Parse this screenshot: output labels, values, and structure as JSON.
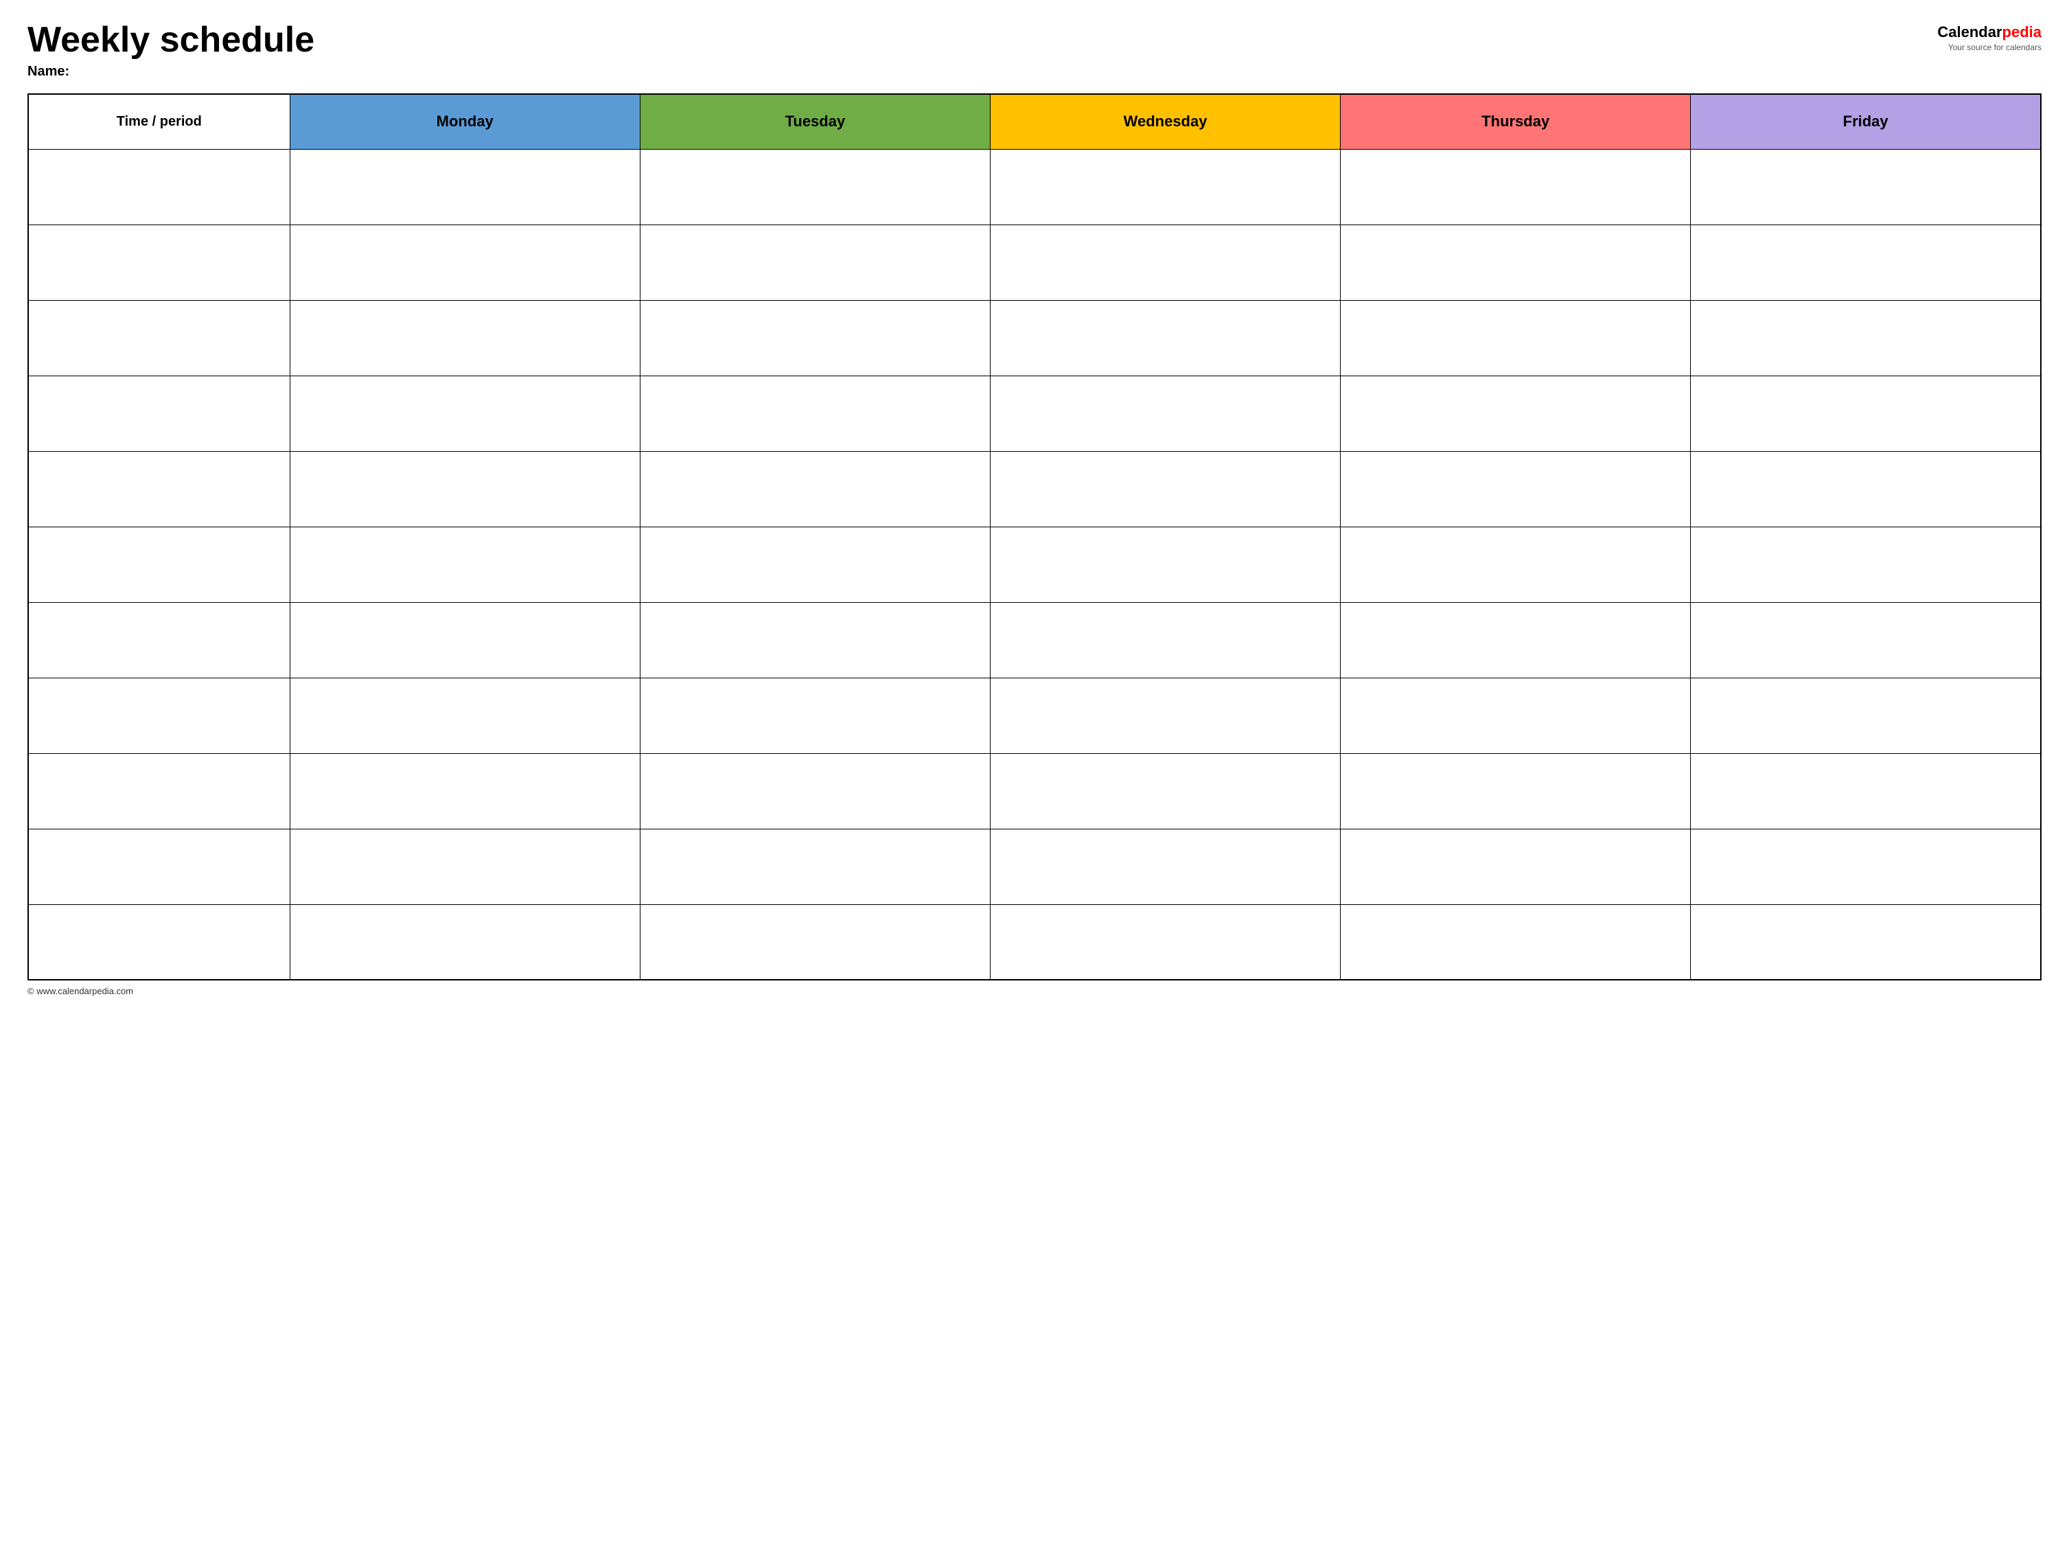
{
  "header": {
    "main_title": "Weekly schedule",
    "name_label": "Name:",
    "logo_calendar": "Calendar",
    "logo_pedia": "pedia",
    "logo_tagline": "Your source for calendars"
  },
  "table": {
    "columns": [
      {
        "key": "time",
        "label": "Time / period",
        "color": "#ffffff",
        "class": "col-time"
      },
      {
        "key": "monday",
        "label": "Monday",
        "color": "#5b9bd5",
        "class": "monday"
      },
      {
        "key": "tuesday",
        "label": "Tuesday",
        "color": "#70ad47",
        "class": "tuesday"
      },
      {
        "key": "wednesday",
        "label": "Wednesday",
        "color": "#ffc000",
        "class": "wednesday"
      },
      {
        "key": "thursday",
        "label": "Thursday",
        "color": "#ff7575",
        "class": "thursday"
      },
      {
        "key": "friday",
        "label": "Friday",
        "color": "#b4a0e5",
        "class": "friday"
      }
    ],
    "row_count": 11
  },
  "footer": {
    "url": "© www.calendarpedia.com"
  }
}
